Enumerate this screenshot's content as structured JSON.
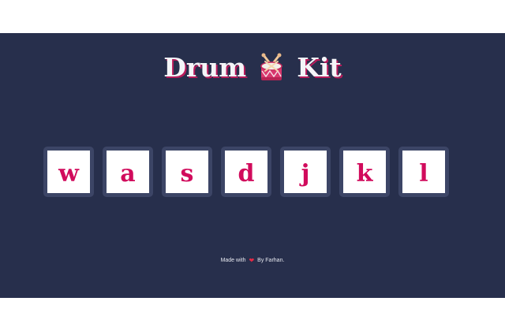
{
  "header": {
    "title_left": "Drum",
    "title_icon": "drum-icon",
    "title_right": "Kit"
  },
  "keys": [
    {
      "letter": "w"
    },
    {
      "letter": "a"
    },
    {
      "letter": "s"
    },
    {
      "letter": "d"
    },
    {
      "letter": "j"
    },
    {
      "letter": "k"
    },
    {
      "letter": "l"
    }
  ],
  "footer": {
    "prefix": "Made with",
    "icon": "heart-icon",
    "suffix": "By Farhan."
  },
  "colors": {
    "background": "#272f4c",
    "key_border": "#3c4566",
    "key_text": "#d10b5c",
    "title_shadow": "#b81a5a",
    "heart": "#e52a45"
  }
}
